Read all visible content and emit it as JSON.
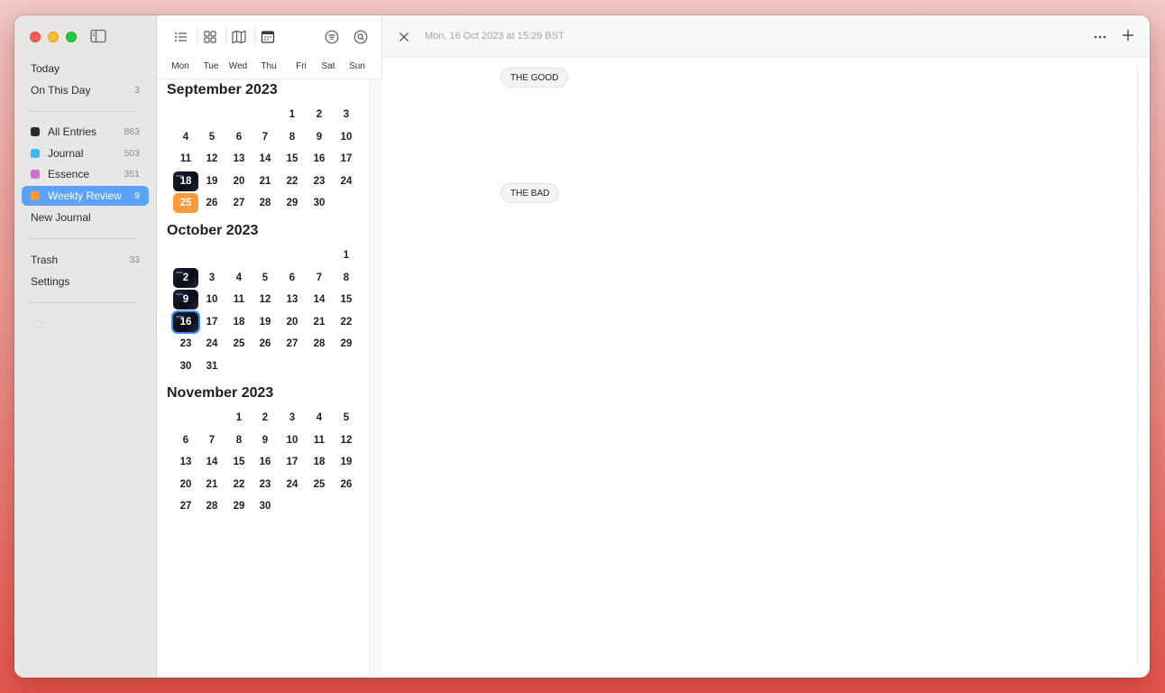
{
  "sidebar": {
    "nav_today": "Today",
    "nav_on_this_day": "On This Day",
    "on_this_day_count": "3",
    "journals": [
      {
        "label": "All Entries",
        "count": "863",
        "color": "#2b2b2b"
      },
      {
        "label": "Journal",
        "count": "503",
        "color": "#39b8f2"
      },
      {
        "label": "Essence",
        "count": "351",
        "color": "#c774d2"
      },
      {
        "label": "Weekly Review",
        "count": "9",
        "color": "#fb9b3c"
      }
    ],
    "active_journal": "Weekly Review",
    "new_journal": "New Journal",
    "trash_label": "Trash",
    "trash_count": "33",
    "settings_label": "Settings"
  },
  "calendar": {
    "toolbar_icons": [
      "list-view-icon",
      "grid-view-icon",
      "map-view-icon",
      "calendar-view-icon",
      "filter-icon",
      "search-icon"
    ],
    "weekdays": [
      "Mon",
      "Tue",
      "Wed",
      "Thu",
      "Fri",
      "Sat",
      "Sun"
    ],
    "months": [
      {
        "title": "September 2023",
        "first_weekday": 4,
        "days": 30,
        "photo_days": [
          18
        ],
        "orange_days": [
          25
        ],
        "selected_day": null
      },
      {
        "title": "October 2023",
        "first_weekday": 6,
        "days": 31,
        "photo_days": [
          2,
          9,
          16
        ],
        "orange_days": [],
        "selected_day": 16
      },
      {
        "title": "November 2023",
        "first_weekday": 2,
        "days": 30,
        "photo_days": [],
        "orange_days": [],
        "selected_day": null
      }
    ]
  },
  "editor": {
    "date": "Mon, 16 Oct 2023 at 15:29 BST",
    "tag_good": "THE GOOD",
    "tag_bad": "THE BAD"
  },
  "colors": {
    "accent": "#5aa2f8",
    "selection_outline": "#3d8ef8",
    "orange_day": "#fb9b3c"
  }
}
